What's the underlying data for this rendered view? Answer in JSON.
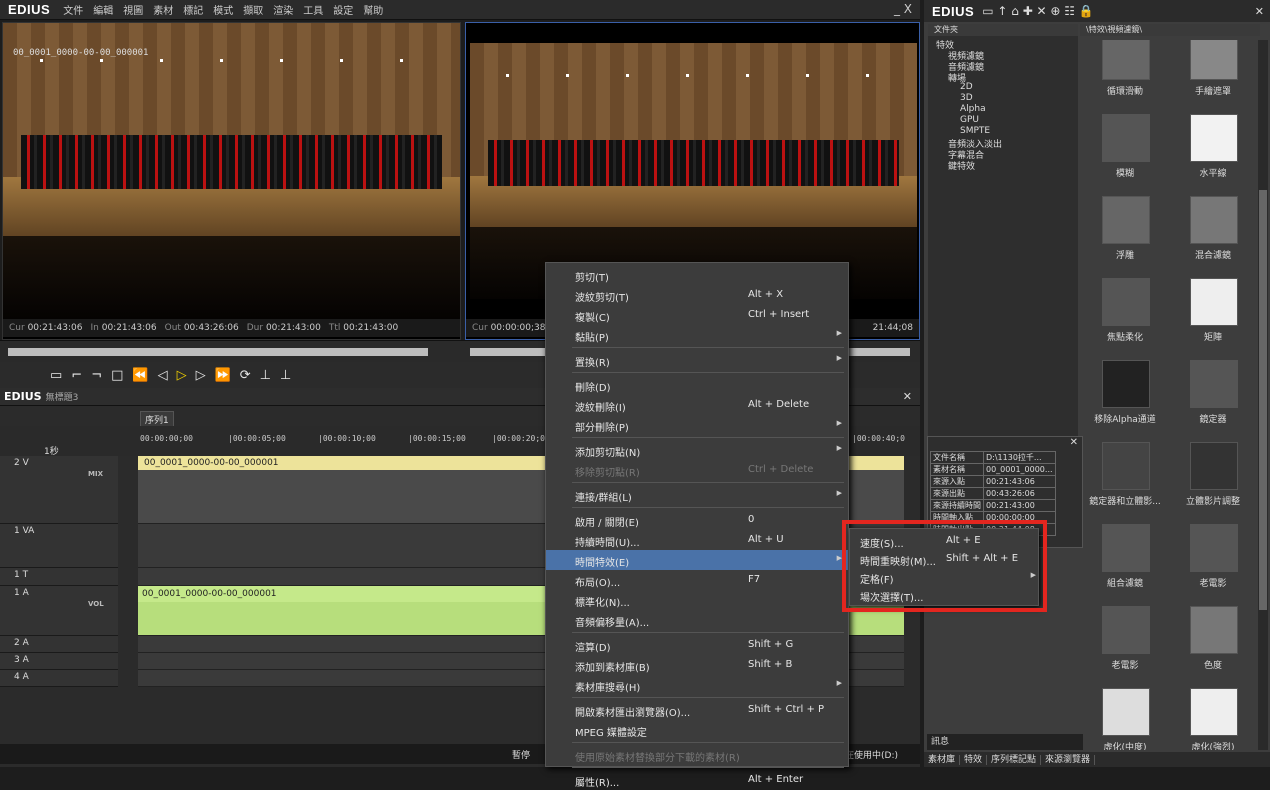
{
  "app": {
    "logo": "EDIUS",
    "menu": [
      "文件",
      "編輯",
      "視圖",
      "素材",
      "標記",
      "模式",
      "擷取",
      "渲染",
      "工具",
      "設定",
      "幫助"
    ],
    "close": "_ X"
  },
  "player": {
    "clip_name": "00_0001_0000-00-00_000001",
    "cur_label": "Cur",
    "cur": "00:21:43:06",
    "in_label": "In",
    "in": "00:21:43:06",
    "out_label": "Out",
    "out": "00:43:26:06",
    "dur_label": "Dur",
    "dur": "00:21:43:00",
    "ttl_label": "Ttl",
    "ttl": "00:21:43:00"
  },
  "recorder": {
    "cur_label": "Cur",
    "cur": "00:00:00;38;",
    "right_tc": "21:44;08"
  },
  "timeline": {
    "title": "EDIUS",
    "project": "無標題3",
    "sequence_tab": "序列1",
    "scale": "1秒",
    "ruler": [
      "00:00:00;00",
      "|00:00:05;00",
      "|00:00:10;00",
      "|00:00:15;00",
      "|00:00:20;0",
      "|00:00:40;0"
    ],
    "tracks": [
      {
        "name": "2 V",
        "extra": "MIX"
      },
      {
        "name": "1 VA",
        "extra": ""
      },
      {
        "name": "1 T",
        "extra": ""
      },
      {
        "name": "1 A",
        "extra": "VOL"
      },
      {
        "name": "2 A",
        "extra": ""
      },
      {
        "name": "3 A",
        "extra": ""
      },
      {
        "name": "4 A",
        "extra": ""
      }
    ],
    "video_clip": "00_0001_0000-00-00_000001",
    "audio_clip": "00_0001_0000-00-00_000001",
    "status_left": "暫停",
    "status_right": "在使用中(D:)"
  },
  "context_menu": [
    {
      "label": "剪切(T)",
      "shortcut": ""
    },
    {
      "label": "波紋剪切(T)",
      "shortcut": "Alt + X"
    },
    {
      "label": "複製(C)",
      "shortcut": "Ctrl + Insert"
    },
    {
      "label": "黏貼(P)",
      "shortcut": ""
    },
    {
      "label": "置換(R)",
      "shortcut": ""
    },
    {
      "label": "刪除(D)",
      "shortcut": ""
    },
    {
      "label": "波紋刪除(I)",
      "shortcut": "Alt + Delete"
    },
    {
      "label": "部分刪除(P)",
      "shortcut": ""
    },
    {
      "label": "添加剪切點(N)",
      "shortcut": ""
    },
    {
      "label": "移除剪切點(R)",
      "shortcut": "Ctrl + Delete"
    },
    {
      "label": "連接/群組(L)",
      "shortcut": ""
    },
    {
      "label": "啟用 / 關閉(E)",
      "shortcut": "0"
    },
    {
      "label": "持續時間(U)...",
      "shortcut": "Alt + U"
    },
    {
      "label": "時間特效(E)",
      "shortcut": ""
    },
    {
      "label": "布局(O)...",
      "shortcut": "F7"
    },
    {
      "label": "標準化(N)...",
      "shortcut": ""
    },
    {
      "label": "音頻偏移量(A)...",
      "shortcut": ""
    },
    {
      "label": "渲算(D)",
      "shortcut": "Shift + G"
    },
    {
      "label": "添加到素材庫(B)",
      "shortcut": "Shift + B"
    },
    {
      "label": "素材庫搜尋(H)",
      "shortcut": ""
    },
    {
      "label": "開啟素材匯出瀏覽器(O)...",
      "shortcut": "Shift + Ctrl + P"
    },
    {
      "label": "MPEG 媒體設定",
      "shortcut": ""
    },
    {
      "label": "使用原始素材替換部分下載的素材(R)",
      "shortcut": ""
    },
    {
      "label": "屬性(R)...",
      "shortcut": "Alt + Enter"
    }
  ],
  "submenu": [
    {
      "label": "速度(S)...",
      "shortcut": "Alt + E"
    },
    {
      "label": "時間重映射(M)...",
      "shortcut": "Shift + Alt + E"
    },
    {
      "label": "定格(F)",
      "shortcut": ""
    },
    {
      "label": "場次選擇(T)...",
      "shortcut": ""
    }
  ],
  "right": {
    "logo": "EDIUS",
    "tree_title": "文件夾",
    "path": "\\特效\\視頻濾鏡\\",
    "tree": [
      "特效",
      "視頻濾鏡",
      "音頻濾鏡",
      "轉場",
      "2D",
      "3D",
      "Alpha",
      "GPU",
      "SMPTE",
      "音頻淡入淡出",
      "字幕混合",
      "鍵特效"
    ],
    "effects": [
      "循環滑動",
      "手繪遮罩",
      "模糊",
      "水平線",
      "浮雕",
      "混合濾鏡",
      "焦點柔化",
      "矩陣",
      "移除Alpha通道",
      "鏡定器",
      "鏡定器和立體影...",
      "立體影片調整",
      "組合濾鏡",
      "老電影",
      "老電影",
      "色度",
      "虛化(中度)",
      "虛化(強烈)"
    ],
    "blur_text": "Blur",
    "soft_text": "Soft",
    "threed": "3D",
    "info_rows": [
      [
        "文件名稱",
        "D:\\1130拉千..."
      ],
      [
        "素材名稱",
        "00_0001_0000..."
      ],
      [
        "來源入點",
        "00:21:43:06"
      ],
      [
        "來源出點",
        "00:43:26:06"
      ],
      [
        "來源持續時間",
        "00:21:43:00"
      ],
      [
        "時間軸入點",
        "00:00:00;00"
      ],
      [
        "時間軸出點",
        "00:21:44;08"
      ]
    ],
    "info_label": "訊息",
    "tabs": [
      "素材庫",
      "特效",
      "序列標記點",
      "來源瀏覽器"
    ]
  }
}
